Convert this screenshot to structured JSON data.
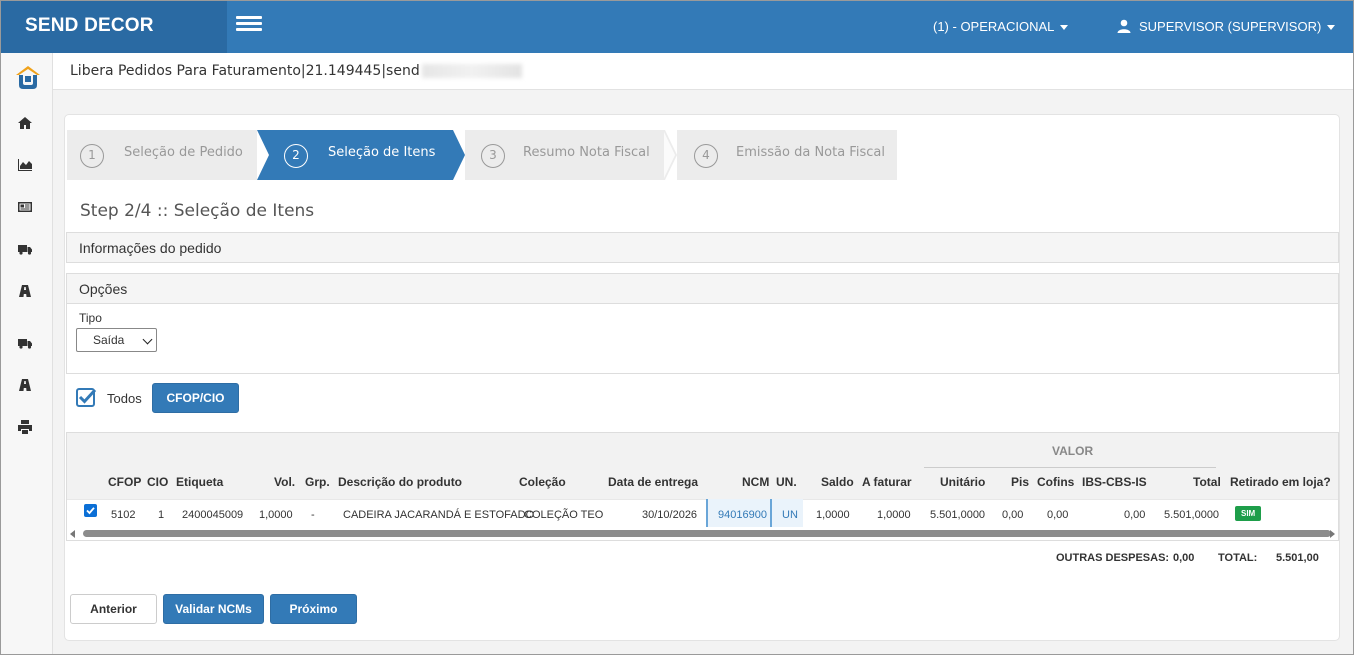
{
  "app": {
    "brand": "SEND DECOR",
    "operacional_menu": "(1) - OPERACIONAL",
    "user_menu": "SUPERVISOR (SUPERVISOR)"
  },
  "page": {
    "title": "Libera Pedidos Para Faturamento|21.149445|send"
  },
  "sidebar": {
    "items": [
      "home-icon",
      "chart-icon",
      "newspaper-icon",
      "truck-icon",
      "road-icon",
      "truck-icon",
      "road-icon",
      "print-icon"
    ]
  },
  "wizard": {
    "steps": [
      {
        "num": "1",
        "label": "Seleção de Pedido"
      },
      {
        "num": "2",
        "label": "Seleção de Itens"
      },
      {
        "num": "3",
        "label": "Resumo Nota Fiscal"
      },
      {
        "num": "4",
        "label": "Emissão da Nota Fiscal"
      }
    ],
    "active_step": 2
  },
  "step_heading": "Step 2/4 :: Seleção de Itens",
  "sections": {
    "info_pedido": "Informações do pedido",
    "opcoes": "Opções"
  },
  "tipo": {
    "label": "Tipo",
    "value": "Saída"
  },
  "todos": {
    "label": "Todos",
    "checked": true
  },
  "buttons": {
    "cfop_cio": "CFOP/CIO",
    "anterior": "Anterior",
    "validar_ncms": "Validar NCMs",
    "proximo": "Próximo"
  },
  "table": {
    "group_header": "VALOR",
    "columns": [
      "CFOP",
      "CIO",
      "Etiqueta",
      "Vol.",
      "Grp.",
      "Descrição do produto",
      "Coleção",
      "Data de entrega",
      "NCM",
      "UN.",
      "Saldo",
      "A faturar",
      "Unitário",
      "Pis",
      "Cofins",
      "IBS-CBS-IS",
      "Total",
      "Retirado em loja?"
    ],
    "rows": [
      {
        "checked": true,
        "cfop": "5102",
        "cio": "1",
        "etiqueta": "2400045009",
        "vol": "1,0000",
        "grp": "-",
        "descricao": "CADEIRA JACARANDÁ E ESTOFADO",
        "colecao": "COLEÇÃO TEO",
        "data_entrega": "30/10/2026",
        "ncm": "94016900",
        "un": "UN",
        "saldo": "1,0000",
        "a_faturar": "1,0000",
        "unitario": "5.501,0000",
        "pis": "0,00",
        "cofins": "0,00",
        "ibs_cbs_is": "0,00",
        "total": "5.501,0000",
        "retirado": "SIM"
      }
    ]
  },
  "totals": {
    "outras_despesas_label": "OUTRAS DESPESAS:",
    "outras_despesas_value": "0,00",
    "total_label": "TOTAL:",
    "total_value": "5.501,00"
  },
  "colors": {
    "primary": "#337ab7",
    "brand_bg": "#2a6aa3",
    "success": "#1e9e4a"
  }
}
